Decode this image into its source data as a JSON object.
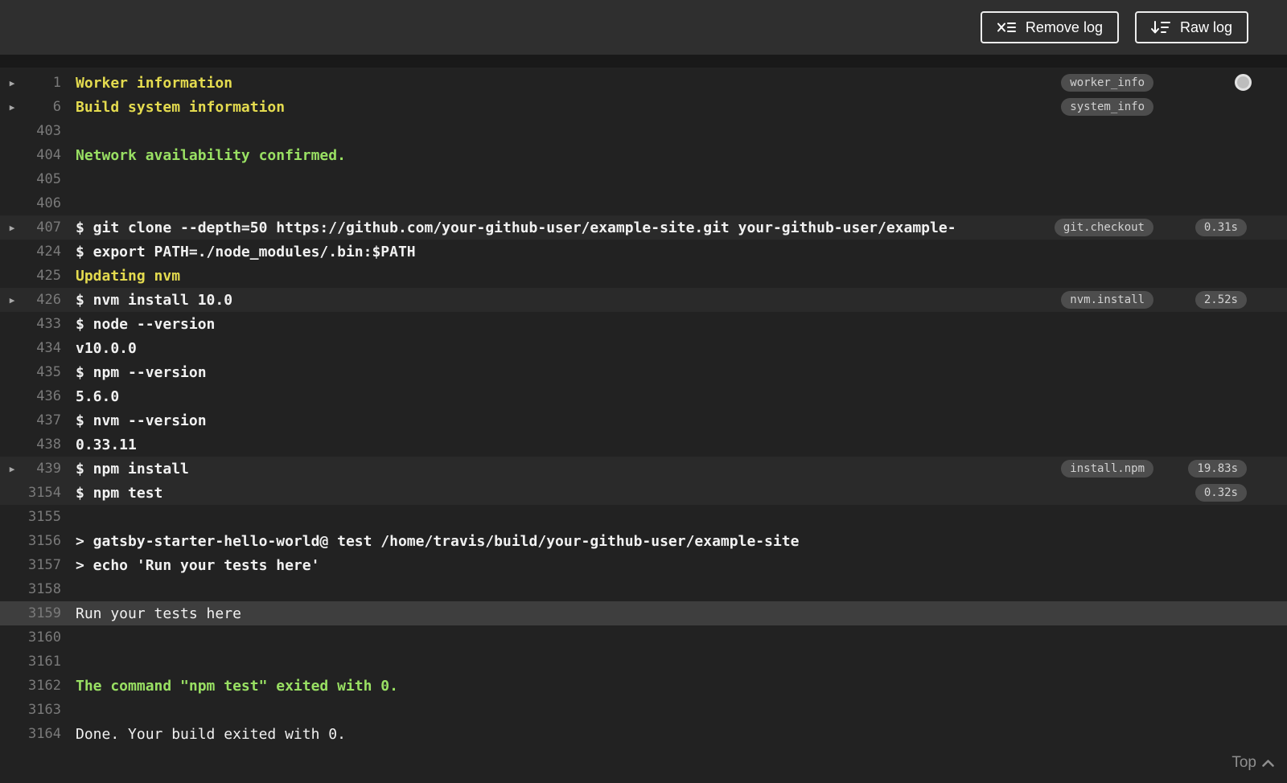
{
  "header": {
    "remove_log": {
      "label": "Remove log",
      "icon": "remove-log-icon"
    },
    "raw_log": {
      "label": "Raw log",
      "icon": "raw-log-icon"
    }
  },
  "log": {
    "lines": [
      {
        "num": "1",
        "text": "Worker information",
        "color": "yellow",
        "bold": true,
        "fold": true,
        "tag": "worker_info"
      },
      {
        "num": "6",
        "text": "Build system information",
        "color": "yellow",
        "bold": true,
        "fold": true,
        "tag": "system_info"
      },
      {
        "num": "403",
        "text": ""
      },
      {
        "num": "404",
        "text": "Network availability confirmed.",
        "color": "green",
        "bold": true
      },
      {
        "num": "405",
        "text": ""
      },
      {
        "num": "406",
        "text": ""
      },
      {
        "num": "407",
        "text": "$ git clone --depth=50 https://github.com/your-github-user/example-site.git your-github-user/example-",
        "bold": true,
        "fold": true,
        "tag": "git.checkout",
        "duration": "0.31s",
        "highlight": "subtle"
      },
      {
        "num": "424",
        "text": "$ export PATH=./node_modules/.bin:$PATH",
        "bold": true
      },
      {
        "num": "425",
        "text": "Updating nvm",
        "color": "yellow",
        "bold": true
      },
      {
        "num": "426",
        "text": "$ nvm install 10.0",
        "bold": true,
        "fold": true,
        "tag": "nvm.install",
        "duration": "2.52s",
        "highlight": "subtle"
      },
      {
        "num": "433",
        "text": "$ node --version",
        "bold": true
      },
      {
        "num": "434",
        "text": "v10.0.0",
        "bold": true
      },
      {
        "num": "435",
        "text": "$ npm --version",
        "bold": true
      },
      {
        "num": "436",
        "text": "5.6.0",
        "bold": true
      },
      {
        "num": "437",
        "text": "$ nvm --version",
        "bold": true
      },
      {
        "num": "438",
        "text": "0.33.11",
        "bold": true
      },
      {
        "num": "439",
        "text": "$ npm install",
        "bold": true,
        "fold": true,
        "tag": "install.npm",
        "duration": "19.83s",
        "highlight": "subtle"
      },
      {
        "num": "3154",
        "text": "$ npm test",
        "bold": true,
        "duration": "0.32s",
        "highlight": "subtle"
      },
      {
        "num": "3155",
        "text": ""
      },
      {
        "num": "3156",
        "text": "> gatsby-starter-hello-world@ test /home/travis/build/your-github-user/example-site",
        "bold": true
      },
      {
        "num": "3157",
        "text": "> echo 'Run your tests here'",
        "bold": true
      },
      {
        "num": "3158",
        "text": ""
      },
      {
        "num": "3159",
        "text": "Run your tests here",
        "highlight": "strong"
      },
      {
        "num": "3160",
        "text": ""
      },
      {
        "num": "3161",
        "text": ""
      },
      {
        "num": "3162",
        "text": "The command \"npm test\" exited with 0.",
        "color": "green",
        "bold": true
      },
      {
        "num": "3163",
        "text": ""
      },
      {
        "num": "3164",
        "text": "Done. Your build exited with 0."
      }
    ]
  },
  "footer": {
    "top_label": "Top"
  },
  "colors": {
    "yellow": "#e4db4f",
    "green": "#99e063",
    "log_bg": "#222222",
    "header_bg": "#2f2f2f",
    "highlight_subtle": "#2a2a2a",
    "highlight_strong": "#3e3e3e"
  }
}
